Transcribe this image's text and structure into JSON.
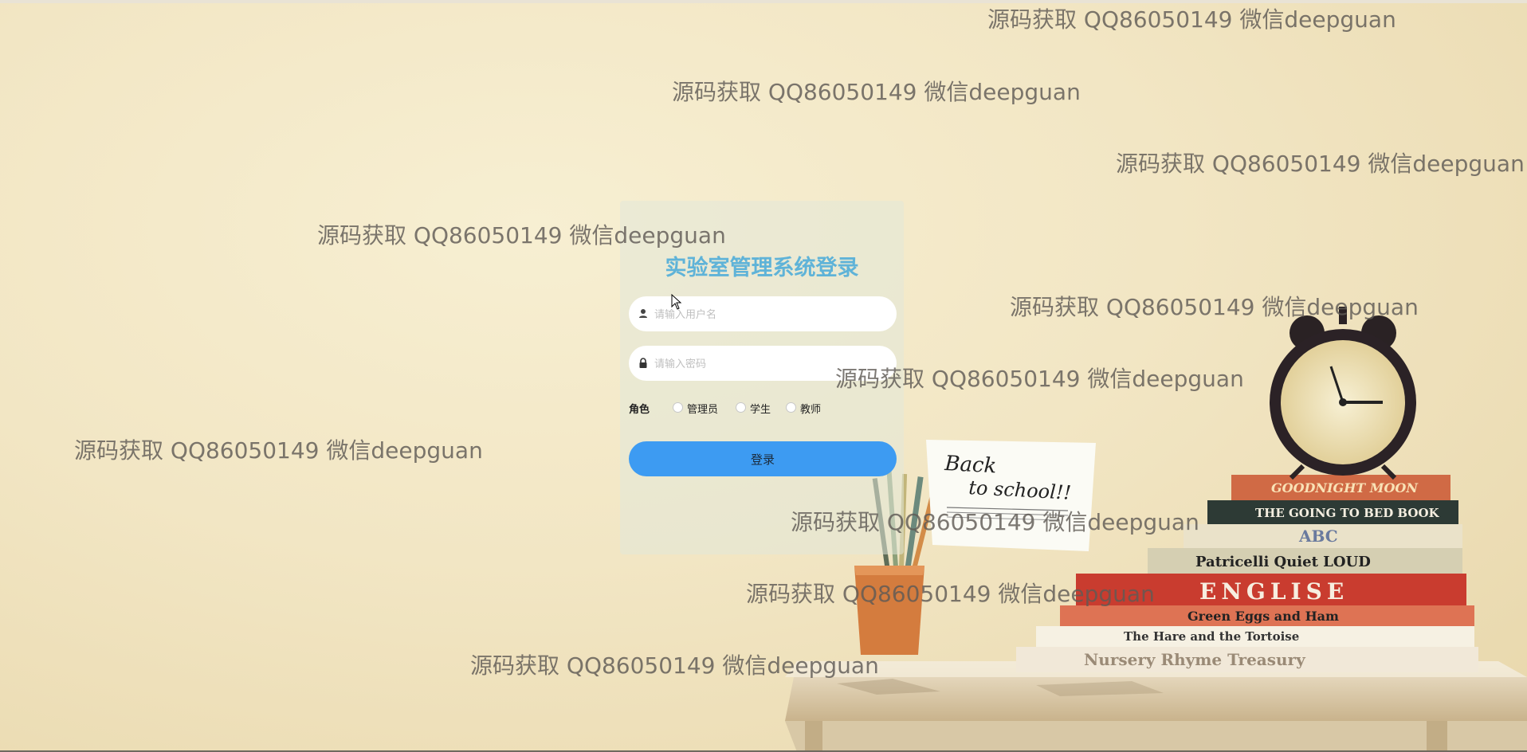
{
  "login": {
    "title": "实验室管理系统登录",
    "username_placeholder": "请输入用户名",
    "password_placeholder": "请输入密码",
    "role_label": "角色",
    "roles": [
      "管理员",
      "学生",
      "教师"
    ],
    "submit_label": "登录",
    "accent_color": "#3d9bf2",
    "title_color": "#5fb3d8"
  },
  "watermark": {
    "text": "源码获取 QQ86050149 微信deepguan"
  },
  "icons": [
    "user-icon",
    "lock-icon",
    "mouse-cursor-icon"
  ]
}
